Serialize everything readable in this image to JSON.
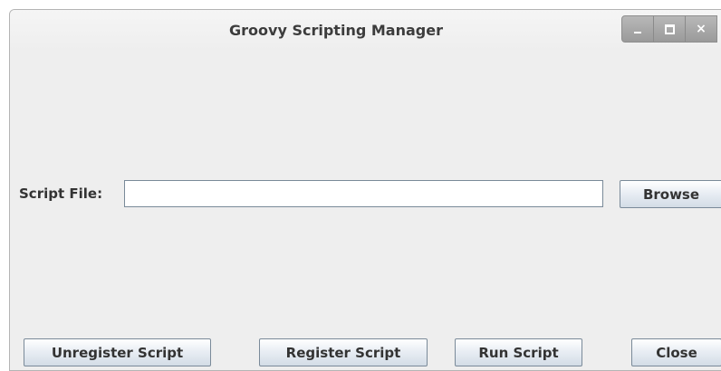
{
  "window": {
    "title": "Groovy Scripting Manager",
    "controls": {
      "minimize_icon": "minimize-icon",
      "maximize_icon": "maximize-icon",
      "close_icon": "close-icon",
      "close_glyph": "×"
    }
  },
  "form": {
    "script_file_label": "Script File:",
    "script_file_value": "",
    "browse_label": "Browse"
  },
  "actions": {
    "unregister_label": "Unregister Script",
    "register_label": "Register Script",
    "run_label": "Run Script",
    "close_label": "Close"
  }
}
